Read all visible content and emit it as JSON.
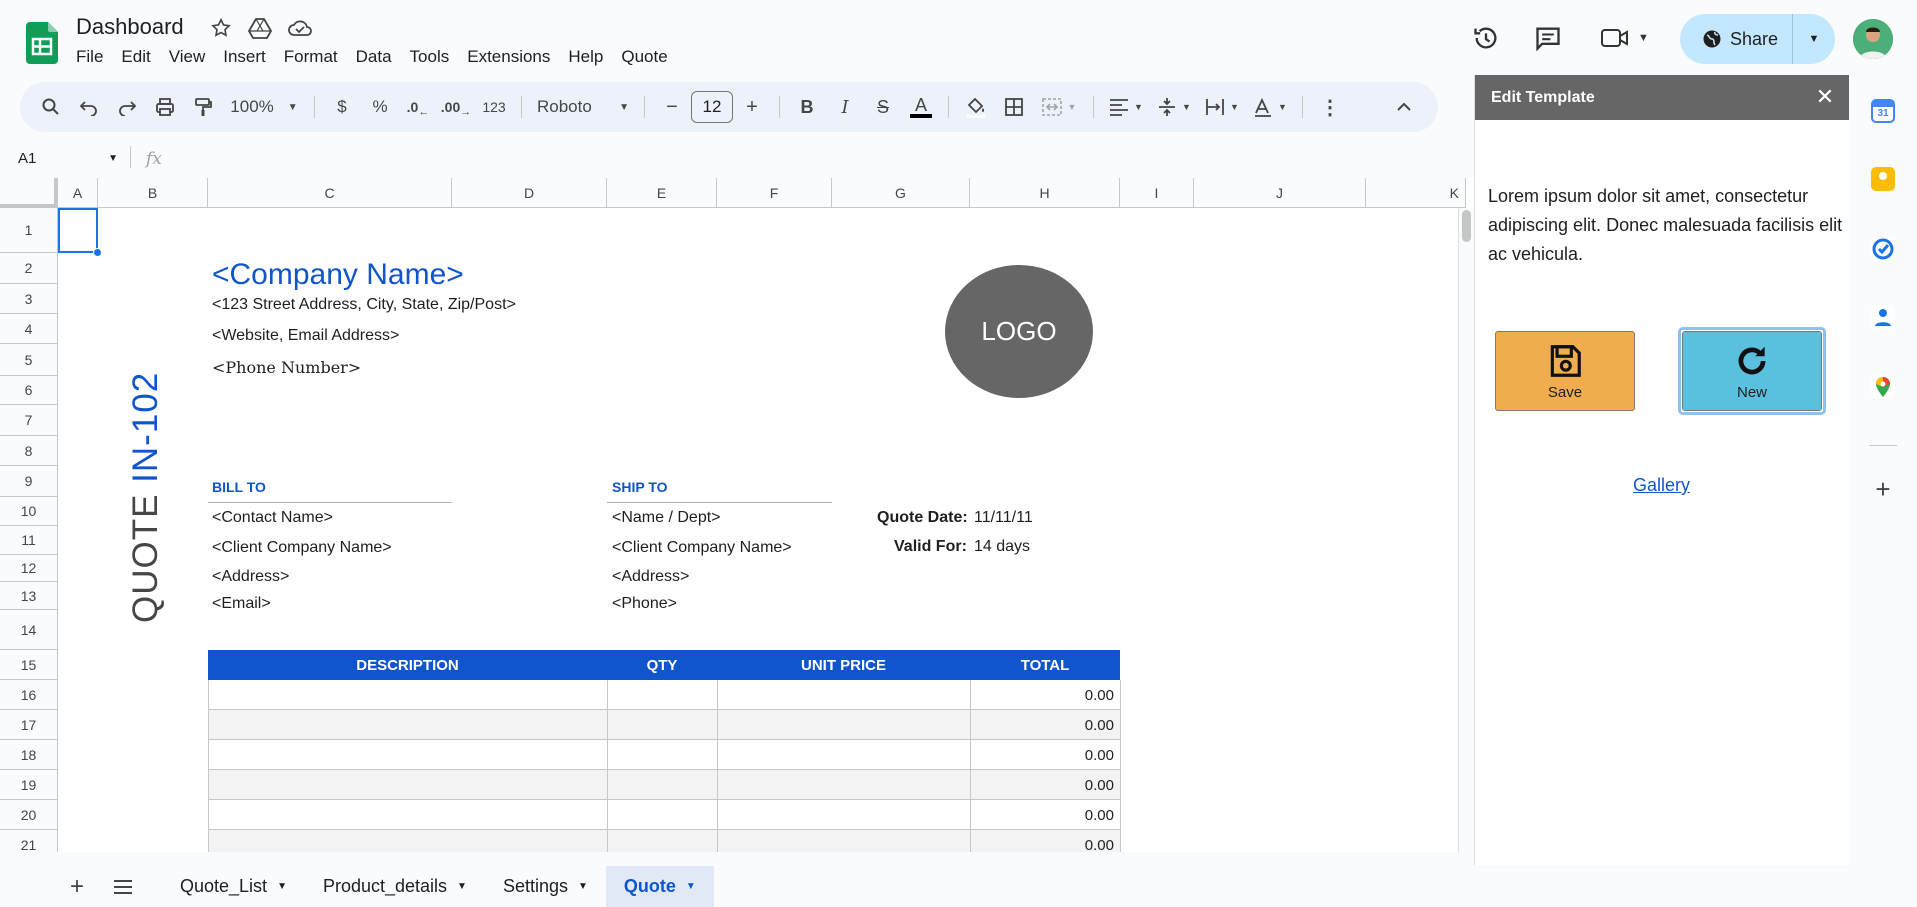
{
  "header": {
    "doc_title": "Dashboard",
    "menu": [
      "File",
      "Edit",
      "View",
      "Insert",
      "Format",
      "Data",
      "Tools",
      "Extensions",
      "Help",
      "Quote"
    ],
    "share_label": "Share"
  },
  "toolbar": {
    "zoom": "100%",
    "currency": "$",
    "percent": "%",
    "dec_decrease": ".0",
    "dec_increase": ".00",
    "number_format": "123",
    "font": "Roboto",
    "font_size": "12"
  },
  "formula_bar": {
    "cell_ref": "A1",
    "fx": "fx"
  },
  "grid": {
    "columns": [
      "A",
      "B",
      "C",
      "D",
      "E",
      "F",
      "G",
      "H",
      "I",
      "J",
      "K"
    ],
    "rows": [
      "1",
      "2",
      "3",
      "4",
      "5",
      "6",
      "7",
      "8",
      "9",
      "10",
      "11",
      "12",
      "13",
      "14",
      "15",
      "16",
      "17",
      "18",
      "19",
      "20",
      "21"
    ]
  },
  "sheet": {
    "company_name": "<Company Name>",
    "address": "<123 Street Address, City, State, Zip/Post>",
    "web_email": "<Website, Email Address>",
    "phone": "<Phone Number>",
    "logo": "LOGO",
    "quote_title_prefix": "QUOTE",
    "quote_title_number": "IN-102",
    "bill_to": {
      "label": "BILL TO",
      "lines": [
        "<Contact Name>",
        "<Client Company Name>",
        "<Address>",
        "<Email>"
      ]
    },
    "ship_to": {
      "label": "SHIP TO",
      "lines": [
        "<Name / Dept>",
        "<Client Company Name>",
        "<Address>",
        "<Phone>"
      ]
    },
    "quote_date_label": "Quote Date:",
    "quote_date": "11/11/11",
    "valid_for_label": "Valid For:",
    "valid_for": "14 days",
    "table_headers": [
      "DESCRIPTION",
      "QTY",
      "UNIT PRICE",
      "TOTAL"
    ],
    "table_totals": [
      "0.00",
      "0.00",
      "0.00",
      "0.00",
      "0.00",
      "0.00"
    ]
  },
  "panel": {
    "title": "Edit Template",
    "text": "Lorem ipsum dolor sit amet, consectetur adipiscing elit. Donec malesuada facilisis elit ac vehicula.",
    "save_label": "Save",
    "new_label": "New",
    "gallery_label": "Gallery",
    "save_color": "#f0ad4e",
    "new_color": "#5bc0de"
  },
  "tabs": {
    "items": [
      "Quote_List",
      "Product_details",
      "Settings",
      "Quote"
    ],
    "active": "Quote"
  }
}
